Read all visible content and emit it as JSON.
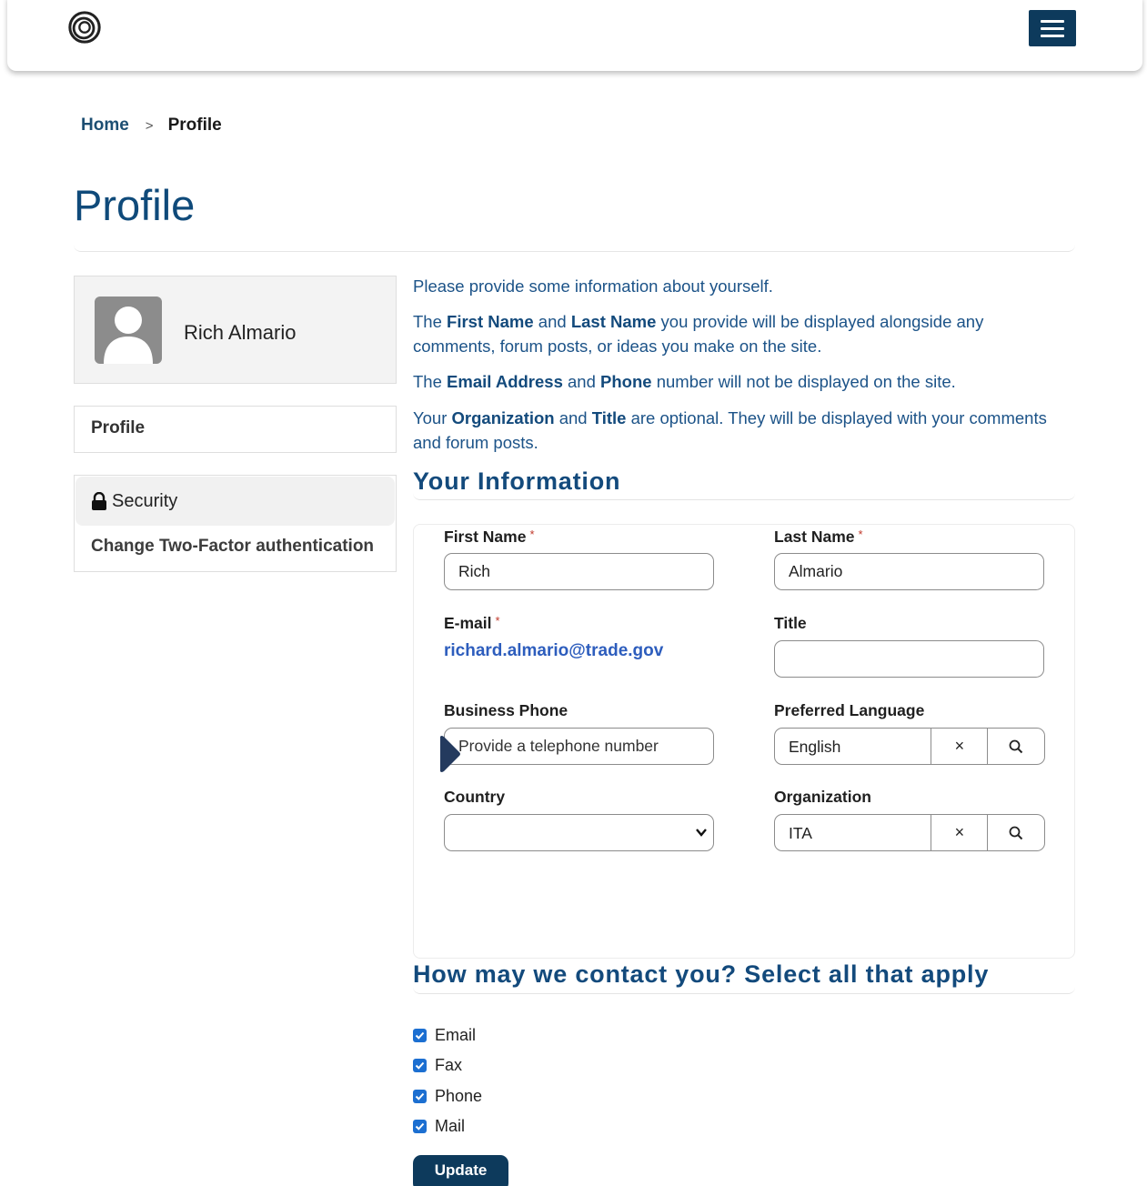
{
  "header": {
    "logo_icon": "circle-swirl-logo-icon",
    "menu_icon": "hamburger-menu-icon"
  },
  "breadcrumb": {
    "home": "Home",
    "separator": ">",
    "current": "Profile"
  },
  "page": {
    "title": "Profile"
  },
  "sidebar": {
    "user_name": "Rich Almario",
    "avatar_icon": "user-avatar-icon",
    "profile_link": "Profile",
    "security_heading": "Security",
    "two_factor_link": "Change Two-Factor authentication"
  },
  "intro": {
    "line1": "Please provide some information about yourself.",
    "p2_a": "The ",
    "p2_first": "First Name",
    "p2_and": " and ",
    "p2_last": "Last Name",
    "p2_rest": " you provide will be displayed alongside any comments, forum posts, or ideas you make on the site.",
    "p3_a": "The ",
    "p3_email": "Email Address",
    "p3_and": " and ",
    "p3_phone": "Phone",
    "p3_rest": " number will not be displayed on the site.",
    "p4_a": "Your ",
    "p4_org": "Organization",
    "p4_and": " and ",
    "p4_title": "Title",
    "p4_rest": " are optional. They will be displayed with your comments and forum posts."
  },
  "your_information": {
    "heading": "Your Information",
    "first_name_label": "First Name",
    "first_name_value": "Rich",
    "last_name_label": "Last Name",
    "last_name_value": "Almario",
    "required_mark": "*",
    "email_label": "E-mail",
    "email_value": "richard.almario@trade.gov",
    "title_label": "Title",
    "title_value": "",
    "business_phone_label": "Business Phone",
    "business_phone_placeholder": "Provide a telephone number",
    "preferred_language_label": "Preferred Language",
    "preferred_language_value": "English",
    "country_label": "Country",
    "country_value": "",
    "organization_label": "Organization",
    "organization_value": "ITA",
    "clear_symbol": "×"
  },
  "contact": {
    "heading": "How may we contact you? Select all that apply",
    "options": [
      {
        "label": "Email",
        "checked": true
      },
      {
        "label": "Fax",
        "checked": true
      },
      {
        "label": "Phone",
        "checked": true
      },
      {
        "label": "Mail",
        "checked": true
      }
    ]
  },
  "actions": {
    "update_label": "Update"
  },
  "colors": {
    "primary": "#0d3a5c",
    "heading": "#134a7c",
    "link": "#2d5dbd",
    "checkbox": "#1c6fd1"
  }
}
